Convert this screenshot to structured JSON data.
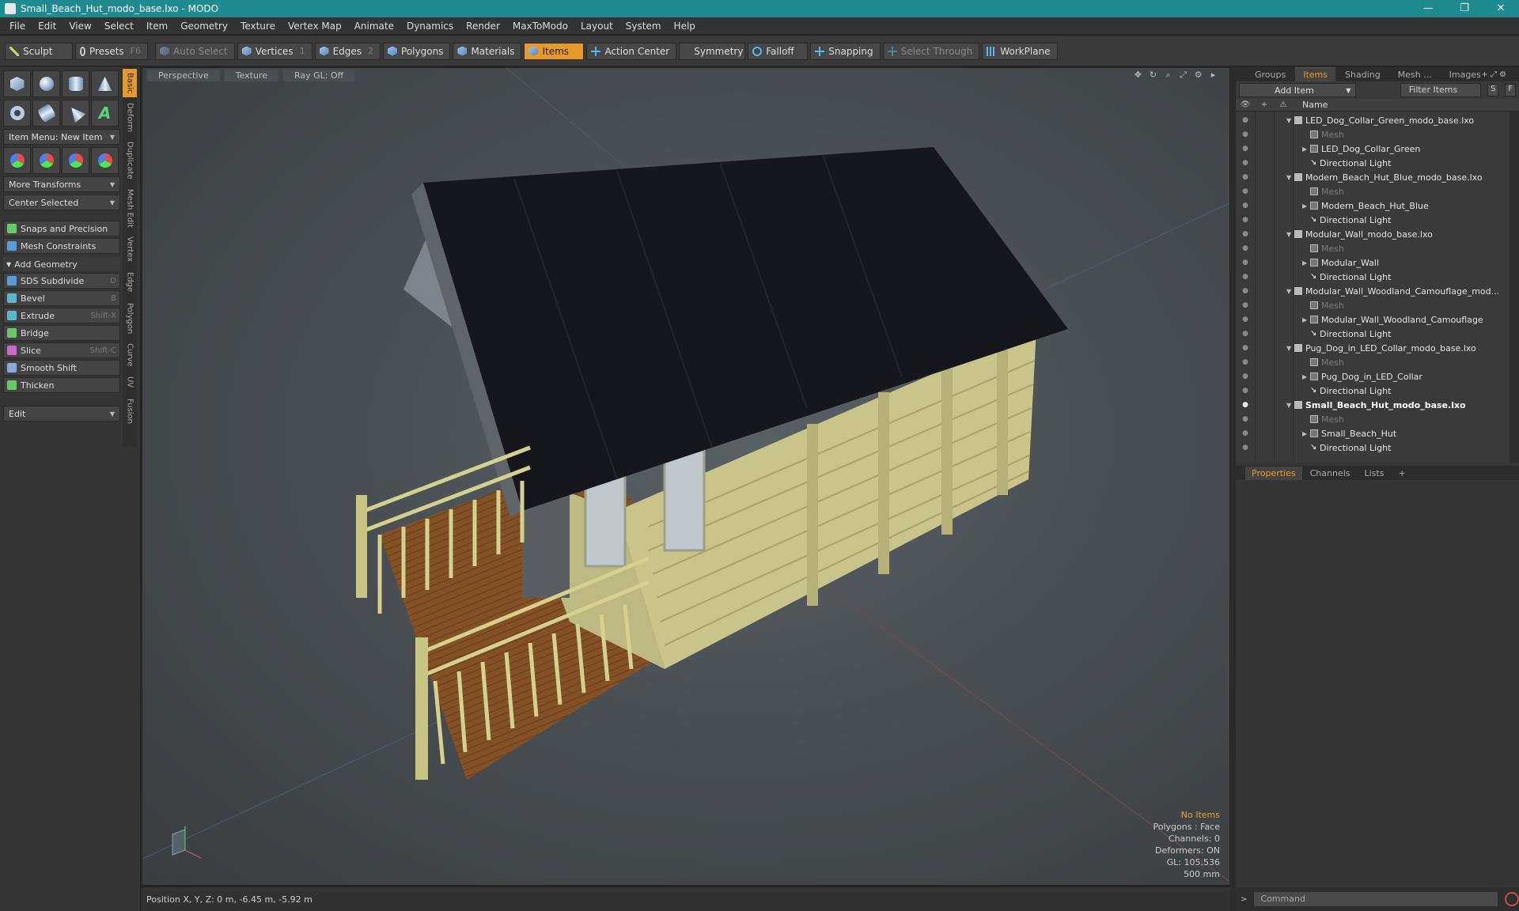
{
  "window": {
    "title": "Small_Beach_Hut_modo_base.lxo - MODO",
    "minimize": "—",
    "maximize": "❐",
    "close": "✕"
  },
  "menu": [
    "File",
    "Edit",
    "View",
    "Select",
    "Item",
    "Geometry",
    "Texture",
    "Vertex Map",
    "Animate",
    "Dynamics",
    "Render",
    "MaxToModo",
    "Layout",
    "System",
    "Help"
  ],
  "toolbar": {
    "sculpt": "Sculpt",
    "presets": "Presets",
    "presets_key": "F6",
    "auto_select": "Auto Select",
    "vertices": "Vertices",
    "vertices_key": "1",
    "edges": "Edges",
    "edges_key": "2",
    "polygons": "Polygons",
    "materials": "Materials",
    "items": "Items",
    "action_center": "Action Center",
    "symmetry": "Symmetry",
    "falloff": "Falloff",
    "snapping": "Snapping",
    "select_through": "Select Through",
    "workplane": "WorkPlane"
  },
  "left": {
    "item_menu": "Item Menu: New Item",
    "more_transforms": "More Transforms",
    "center_selected": "Center Selected",
    "snaps": "Snaps and Precision",
    "mesh_constraints": "Mesh Constraints",
    "add_geometry": "Add Geometry",
    "tools": [
      {
        "label": "SDS Subdivide",
        "key": "D",
        "color": "#5a9ad8"
      },
      {
        "label": "Bevel",
        "key": "B",
        "color": "#5ab8c8"
      },
      {
        "label": "Extrude",
        "key": "Shift-X",
        "color": "#5ab8c8"
      },
      {
        "label": "Bridge",
        "key": "",
        "color": "#6ac86a"
      },
      {
        "label": "Slice",
        "key": "Shift-C",
        "color": "#c86ac8"
      },
      {
        "label": "Smooth Shift",
        "key": "",
        "color": "#8aa8d8"
      },
      {
        "label": "Thicken",
        "key": "",
        "color": "#6ac86a"
      }
    ],
    "edit": "Edit",
    "vtabs": [
      "Basic",
      "Deform",
      "Duplicate",
      "Mesh Edit",
      "Vertex",
      "Edge",
      "Polygon",
      "Curve",
      "UV",
      "Fusion"
    ]
  },
  "viewport": {
    "perspective": "Perspective",
    "texture": "Texture",
    "raygl": "Ray GL: Off",
    "stats": {
      "no_items": "No Items",
      "polygons": "Polygons : Face",
      "channels": "Channels: 0",
      "deformers": "Deformers: ON",
      "gl": "GL: 105,536",
      "unit": "500 mm"
    }
  },
  "status": {
    "position": "Position X, Y, Z:  0 m, -6.45 m, -5.92 m"
  },
  "right": {
    "tabs": [
      "Groups",
      "Items",
      "Shading",
      "Mesh ...",
      "Images"
    ],
    "add_item": "Add Item",
    "filter": "Filter Items",
    "s": "S",
    "f": "F",
    "col_name": "Name",
    "tree": [
      {
        "label": "LED_Dog_Collar_Green_modo_base.lxo",
        "type": "scene",
        "level": 0
      },
      {
        "label": "Mesh",
        "type": "mesh",
        "level": 1
      },
      {
        "label": "LED_Dog_Collar_Green",
        "type": "group",
        "level": 1
      },
      {
        "label": "Directional Light",
        "type": "light",
        "level": 1
      },
      {
        "label": "Modern_Beach_Hut_Blue_modo_base.lxo",
        "type": "scene",
        "level": 0
      },
      {
        "label": "Mesh",
        "type": "mesh",
        "level": 1
      },
      {
        "label": "Modern_Beach_Hut_Blue",
        "type": "group",
        "level": 1
      },
      {
        "label": "Directional Light",
        "type": "light",
        "level": 1
      },
      {
        "label": "Modular_Wall_modo_base.lxo",
        "type": "scene",
        "level": 0
      },
      {
        "label": "Mesh",
        "type": "mesh",
        "level": 1
      },
      {
        "label": "Modular_Wall",
        "type": "group",
        "level": 1
      },
      {
        "label": "Directional Light",
        "type": "light",
        "level": 1
      },
      {
        "label": "Modular_Wall_Woodland_Camouflage_mod...",
        "type": "scene",
        "level": 0
      },
      {
        "label": "Mesh",
        "type": "mesh",
        "level": 1
      },
      {
        "label": "Modular_Wall_Woodland_Camouflage",
        "type": "group",
        "level": 1
      },
      {
        "label": "Directional Light",
        "type": "light",
        "level": 1
      },
      {
        "label": "Pug_Dog_in_LED_Collar_modo_base.lxo",
        "type": "scene",
        "level": 0
      },
      {
        "label": "Mesh",
        "type": "mesh",
        "level": 1
      },
      {
        "label": "Pug_Dog_in_LED_Collar",
        "type": "group",
        "level": 1
      },
      {
        "label": "Directional Light",
        "type": "light",
        "level": 1
      },
      {
        "label": "Small_Beach_Hut_modo_base.lxo",
        "type": "scene",
        "level": 0,
        "bold": true
      },
      {
        "label": "Mesh",
        "type": "mesh",
        "level": 1
      },
      {
        "label": "Small_Beach_Hut",
        "type": "group",
        "level": 1
      },
      {
        "label": "Directional Light",
        "type": "light",
        "level": 1
      }
    ],
    "prop_tabs": [
      "Properties",
      "Channels",
      "Lists"
    ],
    "command": "Command"
  }
}
